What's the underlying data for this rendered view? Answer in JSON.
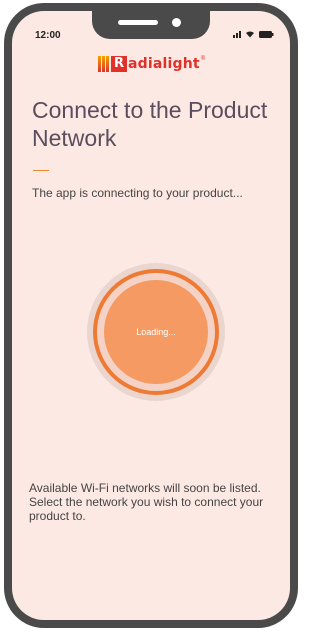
{
  "status_bar": {
    "time": "12:00",
    "icons": [
      "signal-icon",
      "wifi-icon",
      "battery-icon"
    ]
  },
  "logo": {
    "letter": "R",
    "text": "adialight",
    "mark": "®"
  },
  "page": {
    "title": "Connect to the Product Network",
    "subtitle": "The app is connecting to your product...",
    "loading_label": "Loading...",
    "info": "Available Wi-Fi networks will soon be listed. Select the network you wish to connect your product to."
  },
  "colors": {
    "background": "#fde9e3",
    "accent": "#ef7a33",
    "loader_fill": "#f59a63",
    "title": "#5a4d5e",
    "brand": "#e0312a"
  }
}
